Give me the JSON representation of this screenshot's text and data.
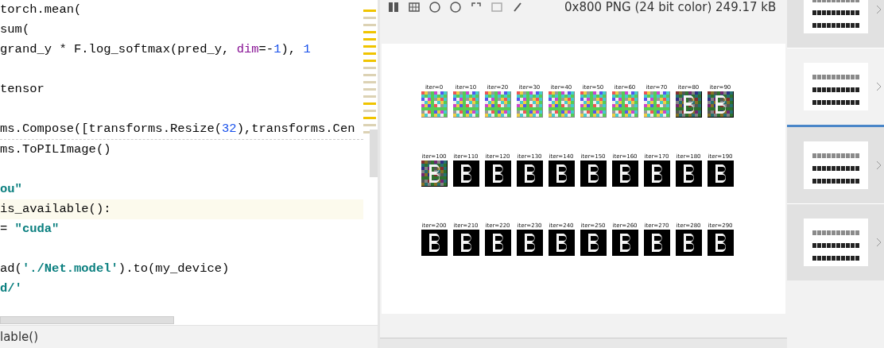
{
  "editor": {
    "lines": [
      {
        "current": false,
        "separated": false,
        "tokens": [
          {
            "text": "torch.mean(",
            "kind": "plain"
          }
        ]
      },
      {
        "current": false,
        "separated": false,
        "tokens": [
          {
            "text": "sum(",
            "kind": "plain"
          }
        ]
      },
      {
        "current": false,
        "separated": false,
        "tokens": [
          {
            "text": "grand_y * F.log_softmax(pred_y, ",
            "kind": "plain"
          },
          {
            "text": "dim",
            "kind": "param"
          },
          {
            "text": "=-",
            "kind": "plain"
          },
          {
            "text": "1",
            "kind": "number"
          },
          {
            "text": "), ",
            "kind": "plain"
          },
          {
            "text": "1",
            "kind": "number"
          }
        ]
      },
      {
        "current": false,
        "separated": false
      },
      {
        "current": false,
        "separated": false,
        "tokens": [
          {
            "text": "tensor",
            "kind": "plain"
          }
        ]
      },
      {
        "current": false,
        "separated": false
      },
      {
        "current": false,
        "separated": true,
        "tokens": [
          {
            "text": "ms.Compose([transforms.Resize(",
            "kind": "plain"
          },
          {
            "text": "32",
            "kind": "number"
          },
          {
            "text": "),transforms.Cen",
            "kind": "plain"
          }
        ]
      },
      {
        "current": false,
        "separated": false,
        "tokens": [
          {
            "text": "ms.ToPILImage()",
            "kind": "plain"
          }
        ]
      },
      {
        "current": false,
        "separated": false
      },
      {
        "current": false,
        "separated": false,
        "tokens": [
          {
            "text": "ou\"",
            "kind": "string"
          }
        ]
      },
      {
        "current": true,
        "separated": false,
        "tokens": [
          {
            "text": "is_available():",
            "kind": "plain"
          }
        ]
      },
      {
        "current": false,
        "separated": false,
        "tokens": [
          {
            "text": "= ",
            "kind": "plain"
          },
          {
            "text": "\"cuda\"",
            "kind": "string"
          }
        ]
      },
      {
        "current": false,
        "separated": false
      },
      {
        "current": false,
        "separated": false,
        "tokens": [
          {
            "text": "ad(",
            "kind": "plain"
          },
          {
            "text": "'./Net.model'",
            "kind": "string"
          },
          {
            "text": ").to(my_device)",
            "kind": "plain"
          }
        ]
      },
      {
        "current": false,
        "separated": false,
        "tokens": [
          {
            "text": "d/'",
            "kind": "string"
          }
        ]
      }
    ],
    "breadcrumb": "lable()"
  },
  "viewer": {
    "info": "0x800 PNG (24 bit color) 249.17 kB",
    "rows": [
      [
        {
          "label": "iter=0",
          "kind": "noise"
        },
        {
          "label": "iter=10",
          "kind": "noise"
        },
        {
          "label": "iter=20",
          "kind": "noise"
        },
        {
          "label": "iter=30",
          "kind": "noise"
        },
        {
          "label": "iter=40",
          "kind": "noise"
        },
        {
          "label": "iter=50",
          "kind": "noise"
        },
        {
          "label": "iter=60",
          "kind": "noise"
        },
        {
          "label": "iter=70",
          "kind": "noise"
        },
        {
          "label": "iter=80",
          "kind": "emerging"
        },
        {
          "label": "iter=90",
          "kind": "emerging"
        }
      ],
      [
        {
          "label": "iter=100",
          "kind": "emerging"
        },
        {
          "label": "iter=110",
          "kind": "clean"
        },
        {
          "label": "iter=120",
          "kind": "clean"
        },
        {
          "label": "iter=130",
          "kind": "clean"
        },
        {
          "label": "iter=140",
          "kind": "clean"
        },
        {
          "label": "iter=150",
          "kind": "clean"
        },
        {
          "label": "iter=160",
          "kind": "clean"
        },
        {
          "label": "iter=170",
          "kind": "clean"
        },
        {
          "label": "iter=180",
          "kind": "clean"
        },
        {
          "label": "iter=190",
          "kind": "clean"
        }
      ],
      [
        {
          "label": "iter=200",
          "kind": "clean"
        },
        {
          "label": "iter=210",
          "kind": "clean"
        },
        {
          "label": "iter=220",
          "kind": "clean"
        },
        {
          "label": "iter=230",
          "kind": "clean"
        },
        {
          "label": "iter=240",
          "kind": "clean"
        },
        {
          "label": "iter=250",
          "kind": "clean"
        },
        {
          "label": "iter=260",
          "kind": "clean"
        },
        {
          "label": "iter=270",
          "kind": "clean"
        },
        {
          "label": "iter=280",
          "kind": "clean"
        },
        {
          "label": "iter=290",
          "kind": "clean"
        }
      ]
    ]
  },
  "filmstrip": [
    {
      "selected": false
    },
    {
      "selected": false
    },
    {
      "selected": true
    },
    {
      "selected": false
    }
  ]
}
